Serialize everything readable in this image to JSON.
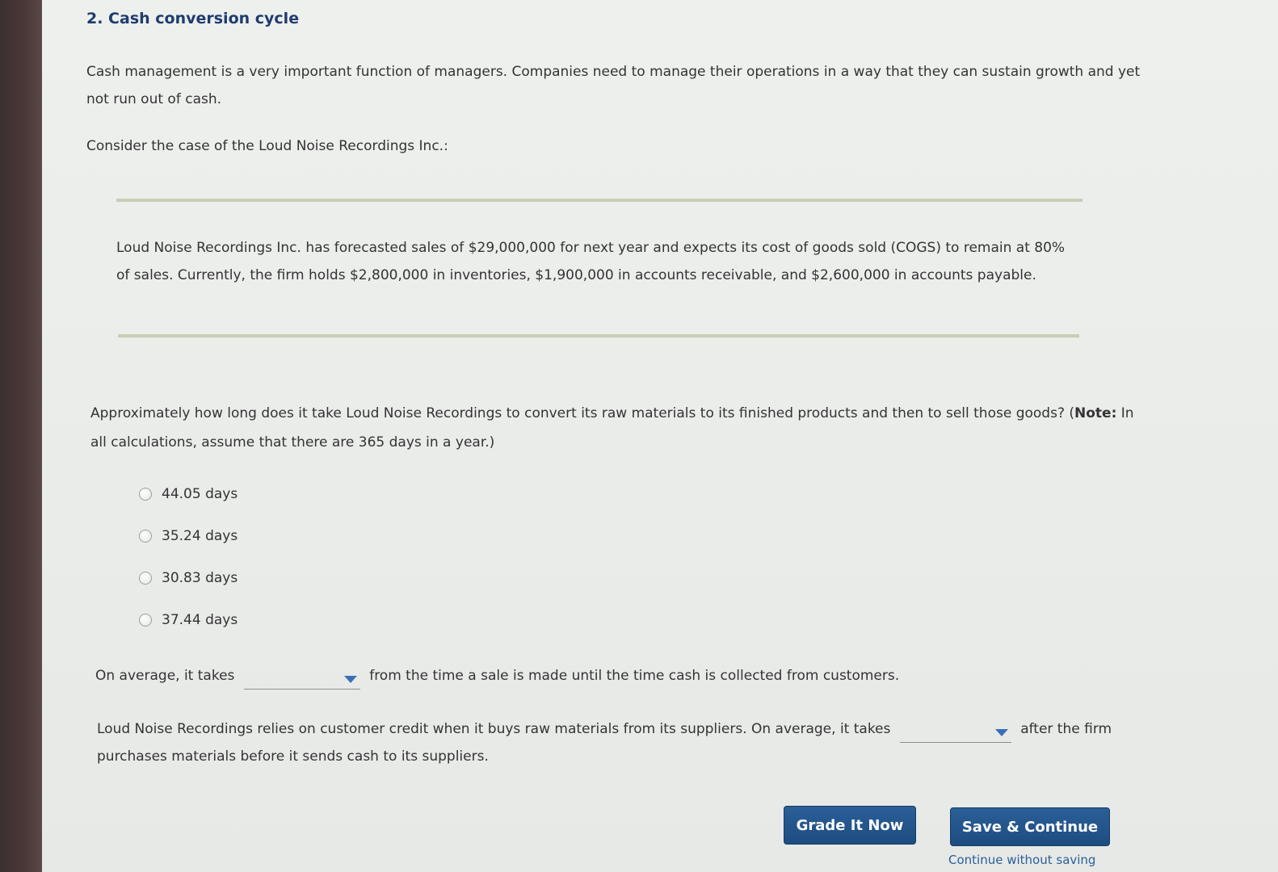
{
  "question": {
    "title": "2. Cash conversion cycle",
    "intro": "Cash management is a very important function of managers. Companies need to manage their operations in a way that they can sustain growth and yet not run out of cash.",
    "consider": "Consider the case of the Loud Noise Recordings Inc.:",
    "scenario": "Loud Noise Recordings Inc. has forecasted sales of $29,000,000 for next year and expects its cost of goods sold (COGS) to remain at 80% of sales. Currently, the firm holds $2,800,000 in inventories, $1,900,000 in accounts receivable, and $2,600,000 in accounts payable.",
    "prompt_before_note": "Approximately how long does it take Loud Noise Recordings to convert its raw materials to its finished products and then to sell those goods? (",
    "note_label": "Note:",
    "prompt_after_note": " In all calculations, assume that there are 365 days in a year.)",
    "options": [
      {
        "label": "44.05 days"
      },
      {
        "label": "35.24 days"
      },
      {
        "label": "30.83 days"
      },
      {
        "label": "37.44 days"
      }
    ]
  },
  "fill_in_1": {
    "before": "On average, it takes",
    "selected": "",
    "after": "from the time a sale is made until the time cash is collected from customers."
  },
  "fill_in_2": {
    "before": "Loud Noise Recordings relies on customer credit when it buys raw materials from its suppliers. On average, it takes",
    "selected": "",
    "after": "after the firm purchases materials before it sends cash to its suppliers."
  },
  "actions": {
    "grade_label": "Grade It Now",
    "save_label": "Save & Continue",
    "continue_label": "Continue without saving"
  },
  "colors": {
    "title": "#1f3c6e",
    "button": "#1e4c80",
    "caret": "#3a6fb8"
  }
}
